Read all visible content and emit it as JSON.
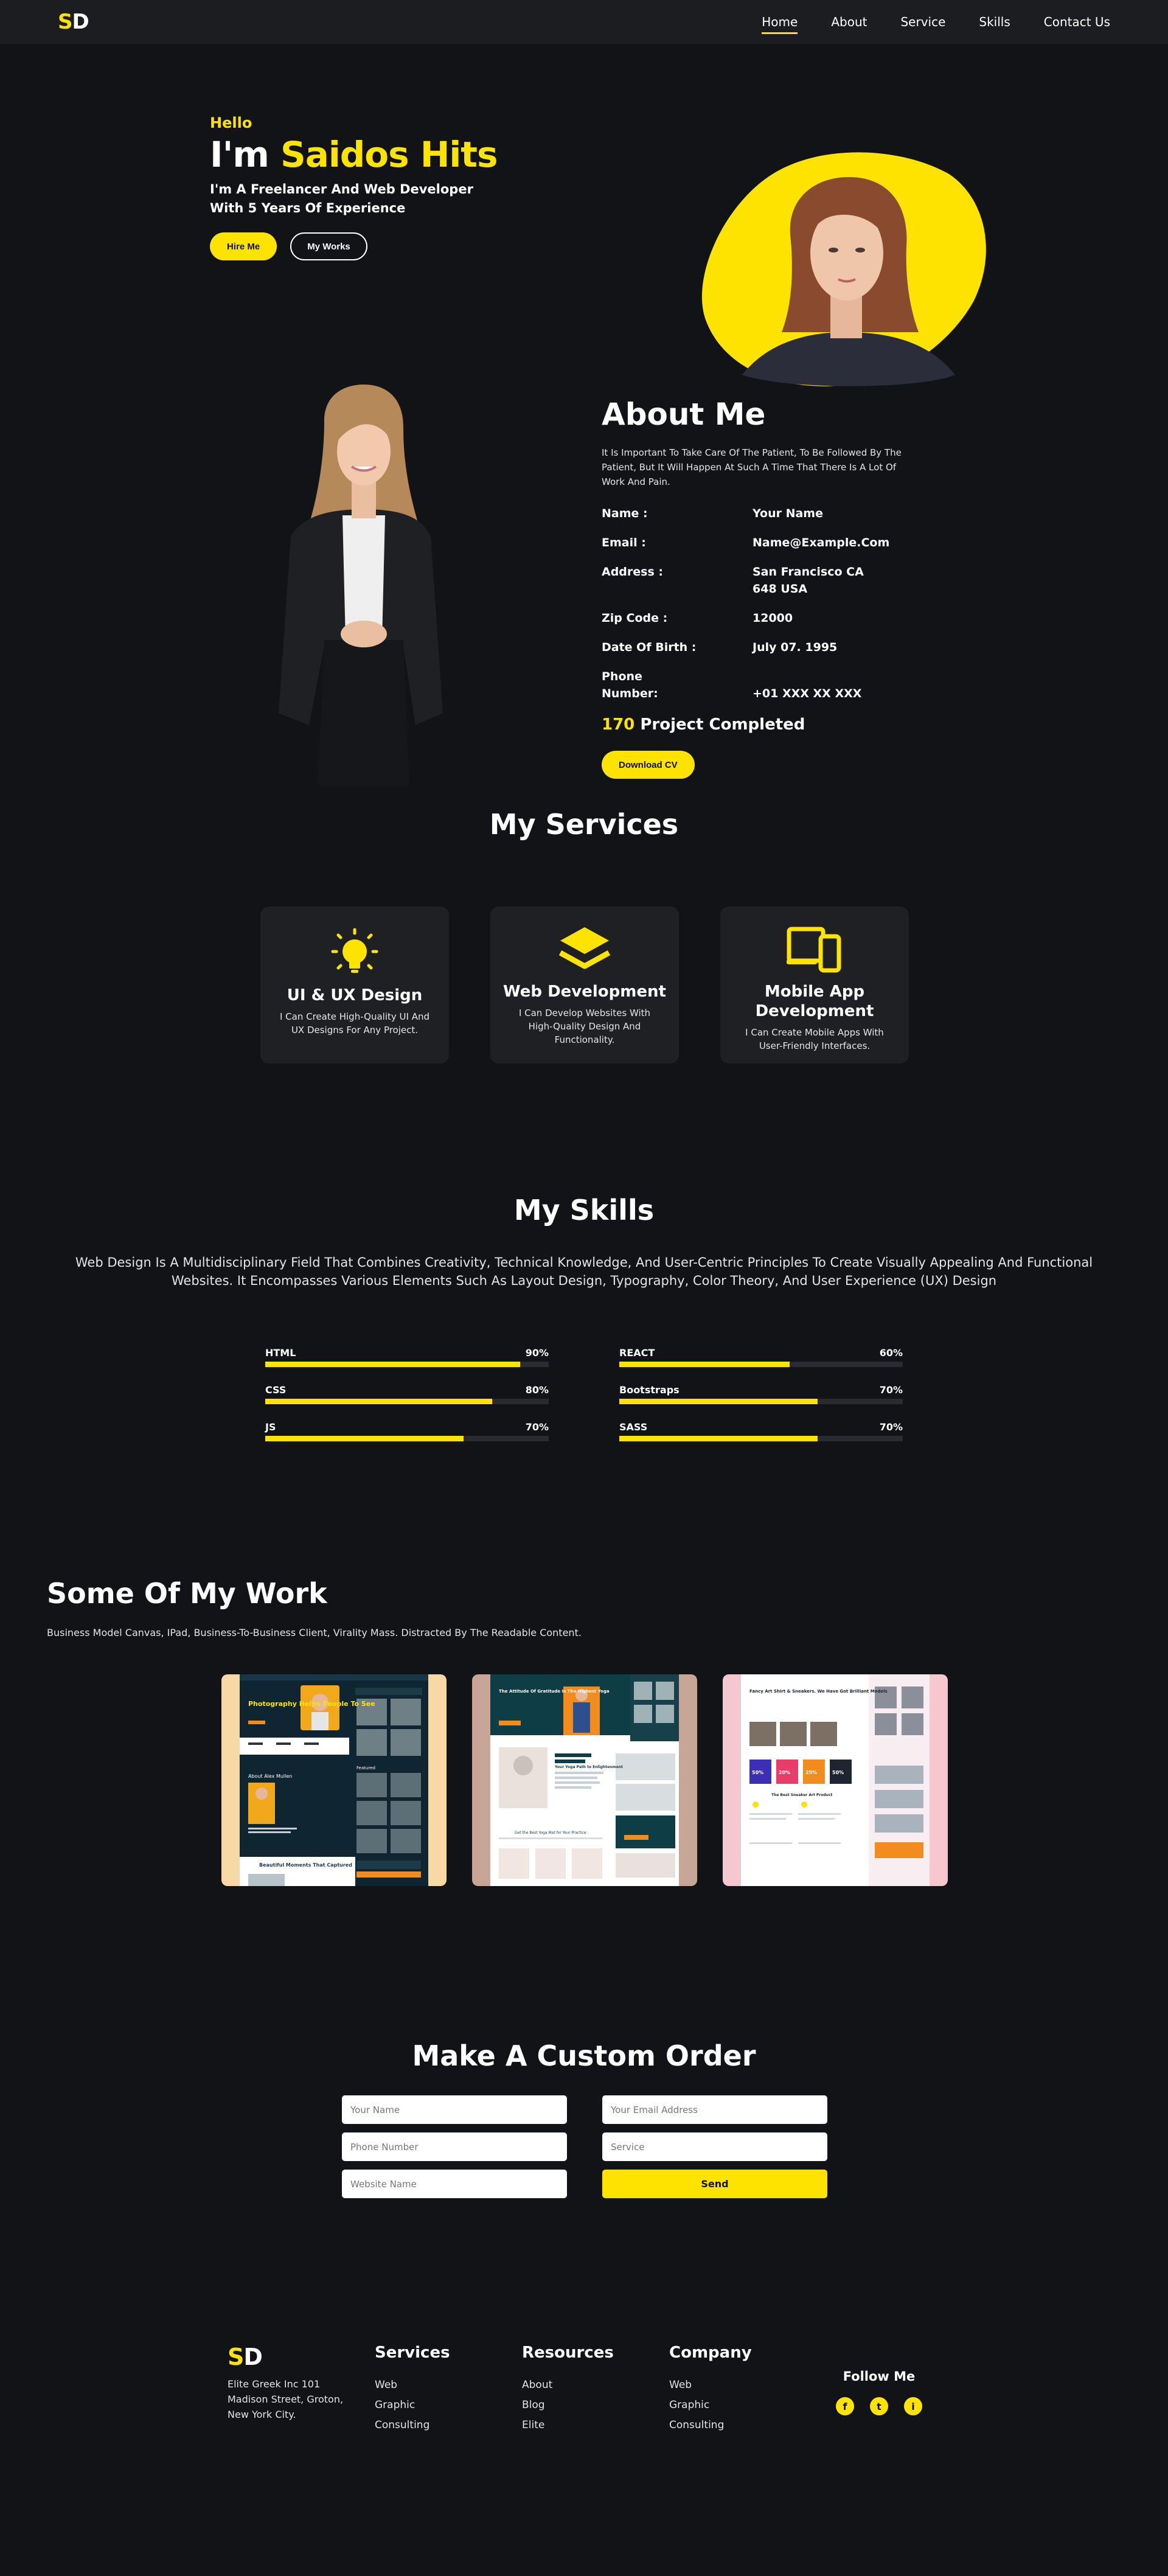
{
  "nav": {
    "logo_s": "S",
    "logo_d": "D",
    "links": [
      "Home",
      "About",
      "Service",
      "Skills",
      "Contact Us"
    ]
  },
  "hero": {
    "hello": "Hello",
    "name_prefix": "I'm",
    "name": "Saidos Hits",
    "subtitle": "I'm A Freelancer And Web Developer With 5 Years Of Experience",
    "hire_btn": "Hire Me",
    "works_btn": "My Works"
  },
  "about": {
    "title": "About Me",
    "desc": "It Is Important To Take Care Of The Patient, To Be Followed By The Patient, But It Will Happen At Such A Time That There Is A Lot Of Work And Pain.",
    "rows": [
      {
        "k": "Name :",
        "v": "Your Name"
      },
      {
        "k": "Email :",
        "v": "Name@Example.Com"
      },
      {
        "k": "Address :",
        "v": "San Francisco CA 648 USA"
      },
      {
        "k": "Zip Code :",
        "v": "12000"
      },
      {
        "k": "Date Of Birth :",
        "v": "July 07. 1995"
      },
      {
        "k": "Phone Number:",
        "v": "+01 XXX XX XXX"
      }
    ],
    "project_count": "170",
    "project_label": "Project Completed",
    "download_btn": "Download CV"
  },
  "services": {
    "title": "My Services",
    "items": [
      {
        "icon": "lightbulb-icon",
        "title": "UI & UX Design",
        "desc": "I Can Create High-Quality UI And UX Designs For Any Project."
      },
      {
        "icon": "layers-icon",
        "title": "Web Development",
        "desc": "I Can Develop Websites With High-Quality Design And Functionality."
      },
      {
        "icon": "devices-icon",
        "title": "Mobile App Development",
        "desc": "I Can Create Mobile Apps With User-Friendly Interfaces."
      }
    ]
  },
  "skills": {
    "title": "My Skills",
    "desc": "Web Design Is A Multidisciplinary Field That Combines Creativity, Technical Knowledge, And User-Centric Principles To Create Visually Appealing And Functional Websites. It Encompasses Various Elements Such As Layout Design, Typography, Color Theory, And User Experience (UX) Design",
    "items": [
      {
        "name": "HTML",
        "pct": "90%",
        "value": 90
      },
      {
        "name": "REACT",
        "pct": "60%",
        "value": 60
      },
      {
        "name": "CSS",
        "pct": "80%",
        "value": 80
      },
      {
        "name": "Bootstraps",
        "pct": "70%",
        "value": 70
      },
      {
        "name": "JS",
        "pct": "70%",
        "value": 70
      },
      {
        "name": "SASS",
        "pct": "70%",
        "value": 70
      }
    ]
  },
  "work": {
    "title": "Some Of My Work",
    "desc": "Business Model Canvas, IPad, Business-To-Business Client, Virality Mass. Distracted By The Readable Content.",
    "card1": {
      "hero": "Photography Helps People To See",
      "about": "About Alex Mullen",
      "featured": "Featured",
      "moments": "Beautiful Moments That Captured"
    },
    "card2": {
      "hero": "The Attitude Of Gratitude Is The Highest Yoga",
      "path": "Your Yoga Path to Enlightenment",
      "mat": "Get the Best Yoga Mat for Your Practice"
    },
    "card3": {
      "hero": "Fancy Art Shirt & Sneakers. We Have Got Brilliant Models",
      "stats": [
        "50%",
        "20%",
        "25%",
        "50%"
      ],
      "featured": "The Best Sneaker Art Product"
    }
  },
  "order": {
    "title": "Make A Custom Order",
    "name_ph": "Your Name",
    "email_ph": "Your Email Address",
    "phone_ph": "Phone Number",
    "service_ph": "Service",
    "website_ph": "Website Name",
    "send": "Send"
  },
  "footer": {
    "logo_s": "S",
    "logo_d": "D",
    "address": "Elite Greek Inc 101 Madison Street, Groton, New York City.",
    "cols": [
      {
        "head": "Services",
        "items": [
          "Web",
          "Graphic",
          "Consulting"
        ]
      },
      {
        "head": "Resources",
        "items": [
          "About",
          "Blog",
          "Elite"
        ]
      },
      {
        "head": "Company",
        "items": [
          "Web",
          "Graphic",
          "Consulting"
        ]
      }
    ],
    "follow": "Follow Me",
    "social": [
      "f",
      "t",
      "i"
    ],
    "social_icons": [
      "facebook-icon",
      "twitter-icon",
      "instagram-icon"
    ]
  },
  "colors": {
    "accent": "#fce300",
    "bg": "#121316",
    "card": "#1f2024"
  }
}
